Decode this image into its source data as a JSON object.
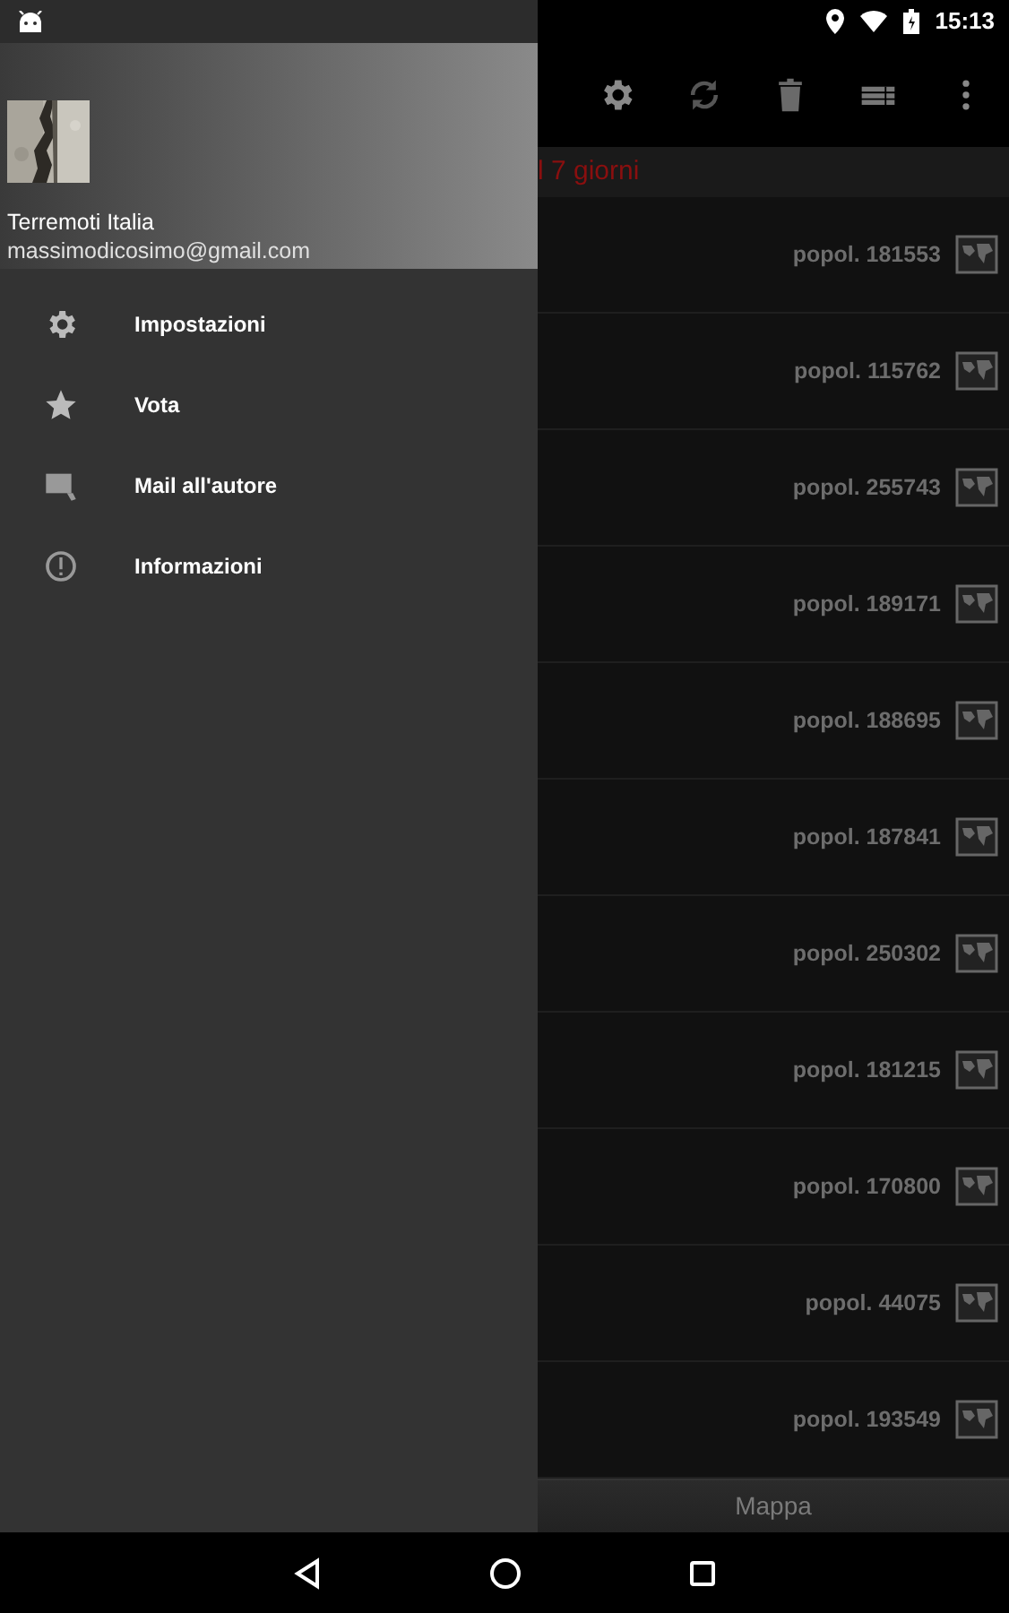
{
  "status_bar": {
    "time": "15:13"
  },
  "drawer": {
    "header": {
      "title": "Terremoti Italia",
      "email": "massimodicosimo@gmail.com"
    },
    "items": [
      {
        "kind": "settings",
        "label": "Impostazioni"
      },
      {
        "kind": "star",
        "label": "Vota"
      },
      {
        "kind": "mail",
        "label": "Mail all'autore"
      },
      {
        "kind": "info",
        "label": "Informazioni"
      }
    ]
  },
  "subtitle": "l 7 giorni",
  "rows": [
    {
      "population": "popol. 181553"
    },
    {
      "population": "popol. 115762"
    },
    {
      "population": "popol. 255743"
    },
    {
      "population": "popol. 189171"
    },
    {
      "population": "popol. 188695"
    },
    {
      "population": "popol. 187841"
    },
    {
      "population": "popol. 250302"
    },
    {
      "population": "popol. 181215"
    },
    {
      "population": "popol. 170800"
    },
    {
      "population": "popol. 44075"
    },
    {
      "population": "popol. 193549"
    }
  ],
  "map_button": "Mappa"
}
